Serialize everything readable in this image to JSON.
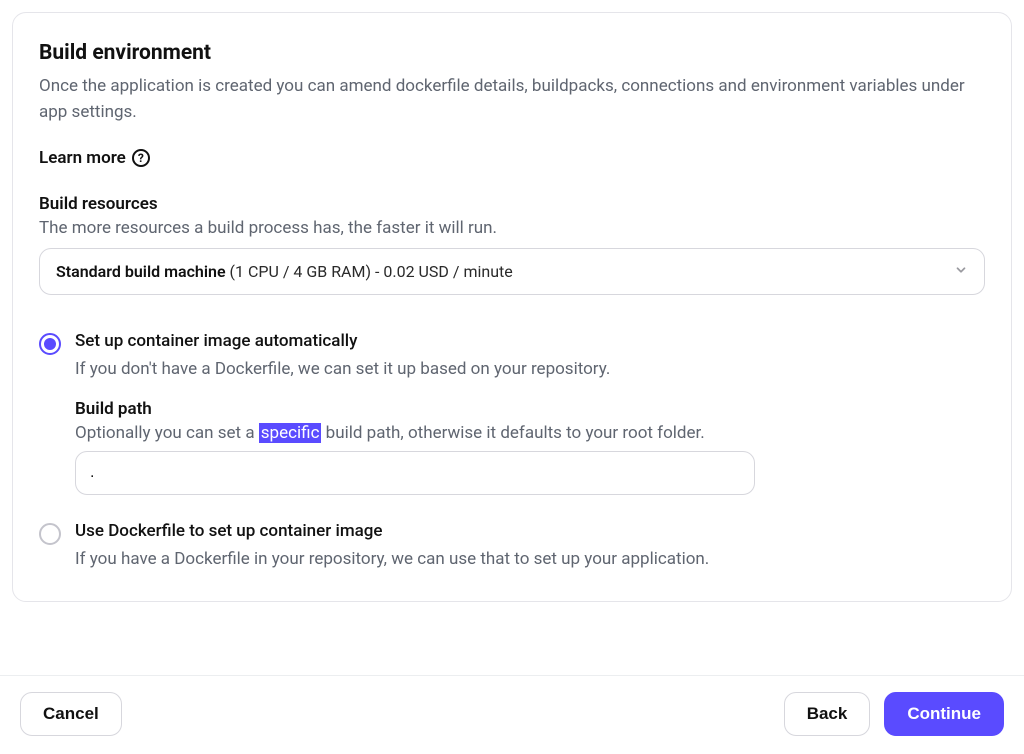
{
  "header": {
    "title": "Build environment",
    "subtitle": "Once the application is created you can amend dockerfile details, buildpacks, connections and environment variables under app settings.",
    "learn_more": "Learn more"
  },
  "build_resources": {
    "label": "Build resources",
    "desc": "The more resources a build process has, the faster it will run.",
    "select_bold": "Standard build machine",
    "select_rest": " (1 CPU / 4 GB RAM) - 0.02 USD / minute"
  },
  "options": {
    "auto": {
      "title": "Set up container image automatically",
      "desc": "If you don't have a Dockerfile, we can set it up based on your repository.",
      "build_path_label": "Build path",
      "build_path_desc_pre": "Optionally you can set a ",
      "build_path_highlight": "specific",
      "build_path_desc_post": " build path, otherwise it defaults to your root folder.",
      "build_path_value": "."
    },
    "dockerfile": {
      "title": "Use Dockerfile to set up container image",
      "desc": "If you have a Dockerfile in your repository, we can use that to set up your application."
    }
  },
  "footer": {
    "cancel": "Cancel",
    "back": "Back",
    "continue": "Continue"
  }
}
